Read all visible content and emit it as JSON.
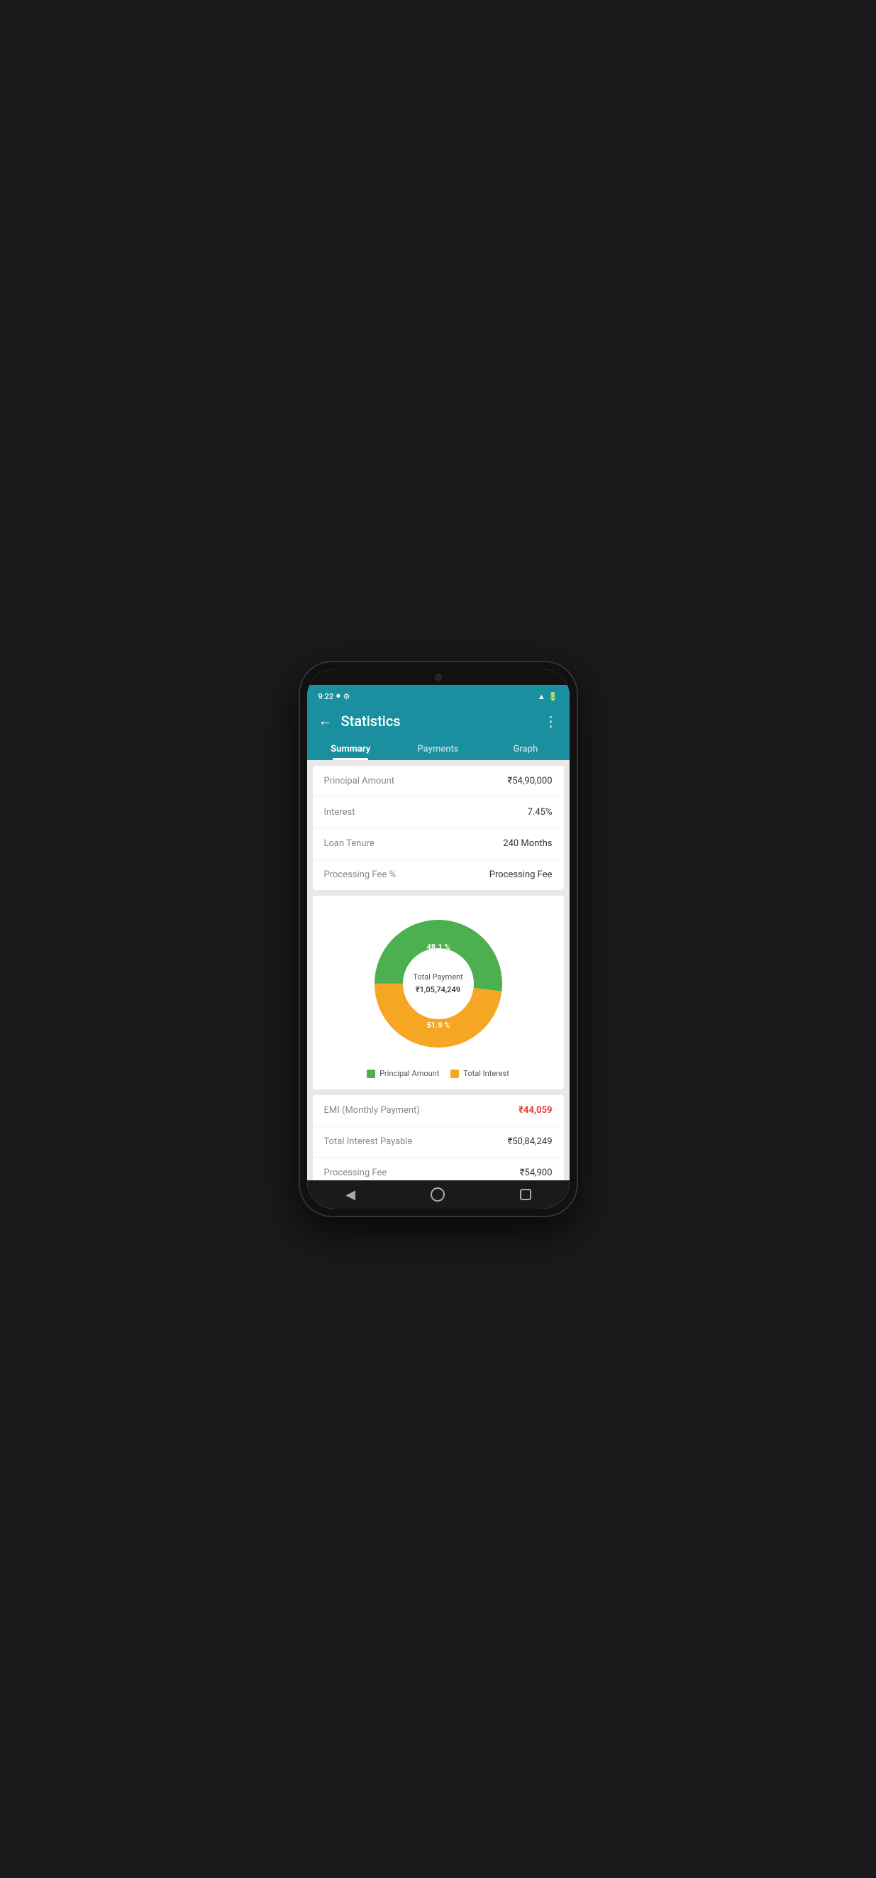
{
  "statusBar": {
    "time": "9:22"
  },
  "header": {
    "title": "Statistics",
    "backLabel": "←",
    "moreLabel": "⋮"
  },
  "tabs": [
    {
      "id": "summary",
      "label": "Summary",
      "active": true
    },
    {
      "id": "payments",
      "label": "Payments",
      "active": false
    },
    {
      "id": "graph",
      "label": "Graph",
      "active": false
    }
  ],
  "summaryRows": [
    {
      "label": "Principal Amount",
      "value": "₹54,90,000"
    },
    {
      "label": "Interest",
      "value": "7.45%"
    },
    {
      "label": "Loan Tenure",
      "value": "240 Months"
    },
    {
      "label": "Processing Fee %",
      "value": "Processing Fee"
    }
  ],
  "chart": {
    "principalPercent": 51.9,
    "interestPercent": 48.1,
    "centerLabel": "Total Payment",
    "centerValue": "₹1,05,74,249",
    "principalColor": "#4caf50",
    "interestColor": "#f5a623",
    "legend": [
      {
        "label": "Principal Amount",
        "color": "#4caf50"
      },
      {
        "label": "Total Interest",
        "color": "#f5a623"
      }
    ]
  },
  "paymentRows": [
    {
      "label": "EMI (Monthly Payment)",
      "value": "₹44,059",
      "highlight": true
    },
    {
      "label": "Total Interest Payable",
      "value": "₹50,84,249",
      "highlight": false
    },
    {
      "label": "Processing Fee",
      "value": "₹54,900",
      "highlight": false
    }
  ]
}
